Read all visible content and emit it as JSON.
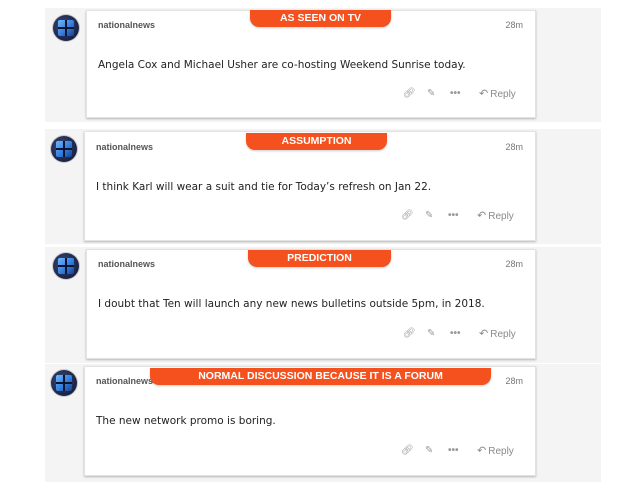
{
  "posts": [
    {
      "tag": "AS SEEN ON TV",
      "username": "nationalnews",
      "time": "28m",
      "text": "Angela Cox and Michael Usher are co-hosting Weekend Sunrise today.",
      "reply_label": "Reply"
    },
    {
      "tag": "ASSUMPTION",
      "username": "nationalnews",
      "time": "28m",
      "text": "I think Karl will wear a suit and tie for Today’s refresh on Jan 22.",
      "reply_label": "Reply"
    },
    {
      "tag": "PREDICTION",
      "username": "nationalnews",
      "time": "28m",
      "text": "I doubt that Ten will launch any new news bulletins outside 5pm, in 2018.",
      "reply_label": "Reply"
    },
    {
      "tag": "NORMAL DISCUSSION BECAUSE IT IS A FORUM",
      "username": "nationalnews",
      "time": "28m",
      "text": "The new network promo is boring.",
      "reply_label": "Reply"
    }
  ],
  "icons": {
    "link": "link-icon",
    "edit": "pencil-icon",
    "more": "more-icon",
    "reply": "reply-arrow-icon"
  },
  "colors": {
    "tag_background": "#f4511e",
    "panel_background": "#f4f4f4"
  }
}
